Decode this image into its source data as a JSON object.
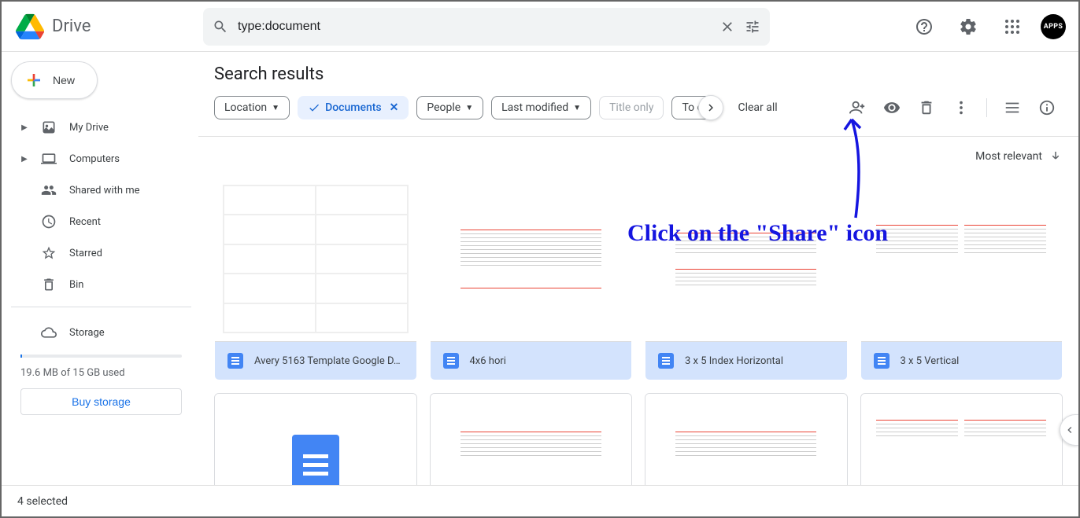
{
  "header": {
    "app_name": "Drive",
    "search_value": "type:document",
    "avatar_text": "APPS"
  },
  "sidebar": {
    "new_label": "New",
    "items": [
      {
        "label": "My Drive",
        "expandable": true
      },
      {
        "label": "Computers",
        "expandable": true
      },
      {
        "label": "Shared with me",
        "expandable": false
      },
      {
        "label": "Recent",
        "expandable": false
      },
      {
        "label": "Starred",
        "expandable": false
      },
      {
        "label": "Bin",
        "expandable": false
      }
    ],
    "storage_label": "Storage",
    "storage_used": "19.6 MB of 15 GB used",
    "buy_label": "Buy storage"
  },
  "content": {
    "title": "Search results",
    "chips": {
      "location": "Location",
      "documents": "Documents",
      "people": "People",
      "last_modified": "Last modified",
      "title_only": "Title only",
      "todo": "To do"
    },
    "clear_all": "Clear all",
    "sort_label": "Most relevant"
  },
  "files": [
    {
      "name": "Avery 5163 Template Google D…"
    },
    {
      "name": "4x6 hori"
    },
    {
      "name": "3 x 5 Index Horizontal"
    },
    {
      "name": "3 x 5 Vertical"
    }
  ],
  "footer": {
    "selected": "4 selected"
  },
  "annotation": {
    "text": "Click on the \"Share\" icon"
  }
}
